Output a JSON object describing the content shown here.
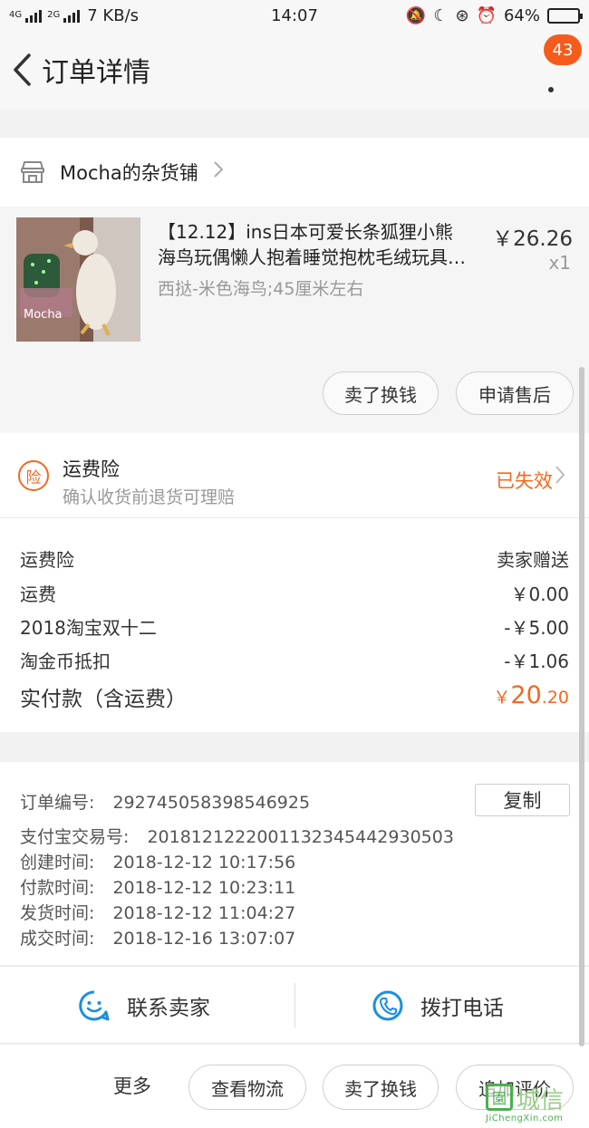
{
  "status_bar": {
    "net_4g": "4G",
    "net_2g": "2G",
    "speed": "7 KB/s",
    "time": "14:07",
    "battery": "64%",
    "battery_level": 0.64
  },
  "nav": {
    "title": "订单详情",
    "badge": "43"
  },
  "shop": {
    "name": "Mocha的杂货铺"
  },
  "item": {
    "title_line1": "【12.12】ins日本可爱长条狐狸小熊",
    "title_line2": "海鸟玩偶懒人抱着睡觉抱枕毛绒玩具…",
    "sku": "西挞-米色海鸟;45厘米左右",
    "price": "￥26.26",
    "qty": "x1",
    "image_watermark": "Mocha",
    "btn_sell": "卖了换钱",
    "btn_aftersale": "申请售后"
  },
  "insurance": {
    "icon_text": "险",
    "title": "运费险",
    "subtitle": "确认收货前退货可理赔",
    "status": "已失效"
  },
  "fees": [
    {
      "label": "运费险",
      "value": "卖家赠送"
    },
    {
      "label": "运费",
      "value": "￥0.00"
    },
    {
      "label": "2018淘宝双十二",
      "value": "-￥5.00"
    },
    {
      "label": "淘金币抵扣",
      "value": "-￥1.06"
    }
  ],
  "total": {
    "label": "实付款（含运费）",
    "currency": "￥",
    "integer": "20",
    "decimal": ".20"
  },
  "order_info": {
    "order_no_label": "订单编号:",
    "order_no": "292745058398546925",
    "copy_label": "复制",
    "alipay_label": "支付宝交易号:",
    "alipay_no": "2018121222001132345442930503",
    "created_label": "创建时间:",
    "created": "2018-12-12 10:17:56",
    "paid_label": "付款时间:",
    "paid": "2018-12-12 10:23:11",
    "shipped_label": "发货时间:",
    "shipped": "2018-12-12 11:04:27",
    "closed_label": "成交时间:",
    "closed": "2018-12-16 13:07:07"
  },
  "contact": {
    "seller": "联系卖家",
    "phone": "拨打电话"
  },
  "bottom": {
    "more": "更多",
    "logistics": "查看物流",
    "sell": "卖了换钱",
    "review": "追加评价"
  },
  "watermark": {
    "text": "城信",
    "url": "JiChengXin.com"
  }
}
